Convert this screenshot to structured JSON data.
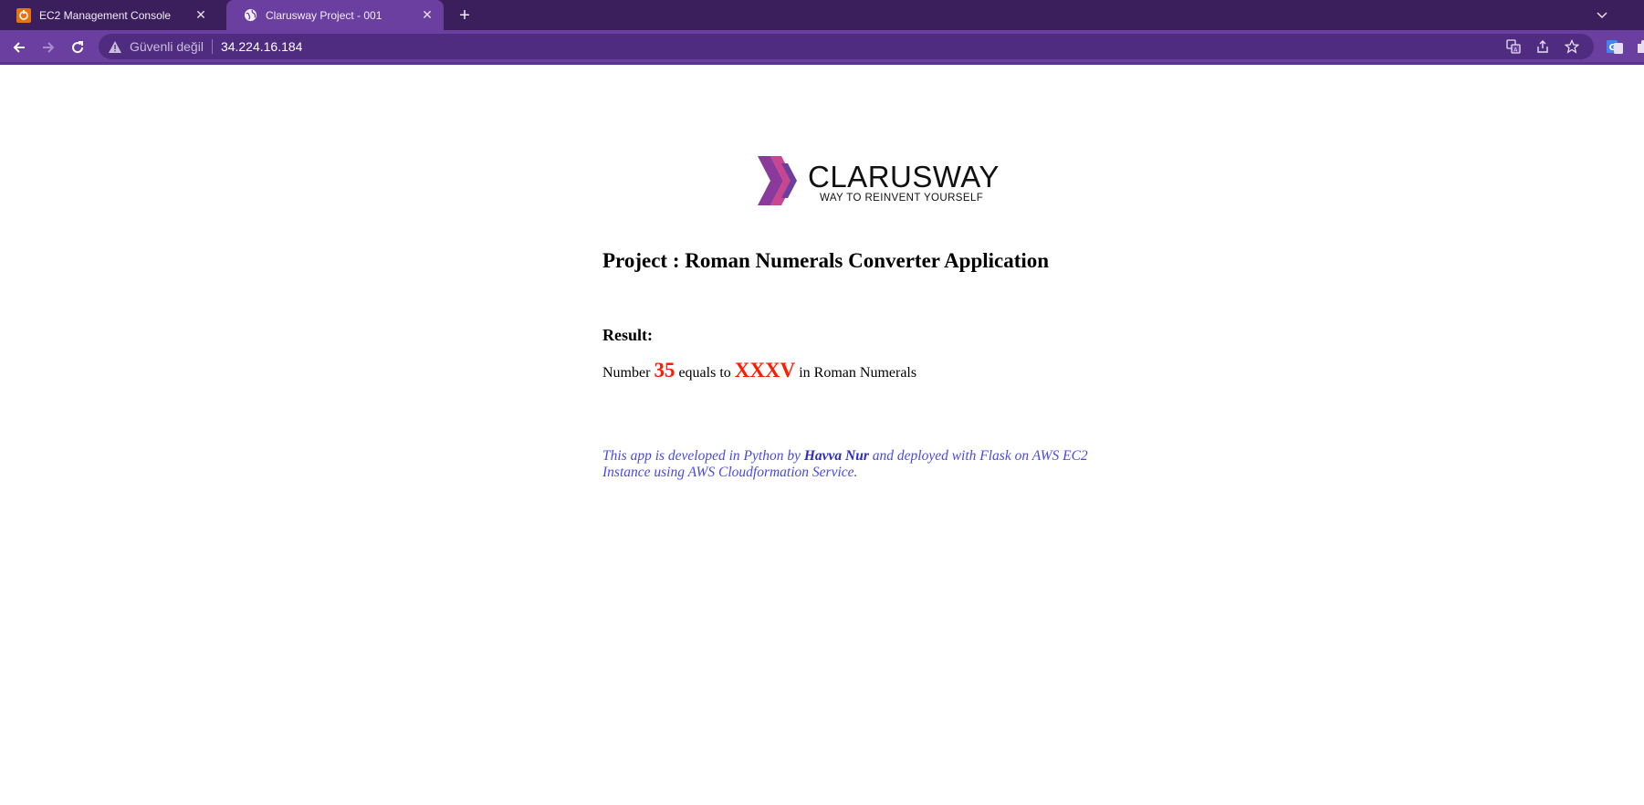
{
  "browser": {
    "tabs": [
      {
        "title": "EC2 Management Console",
        "favicon": "aws-console-icon",
        "active": false
      },
      {
        "title": "Clarusway Project - 001",
        "favicon": "globe-icon",
        "active": true
      }
    ],
    "new_tab_icon": "plus-icon",
    "tab_search_icon": "chevron-down-icon",
    "address_bar": {
      "security_text": "Güvenli değil",
      "security_icon": "warning-triangle-icon",
      "url": "34.224.16.184"
    },
    "colors": {
      "tabstrip": "#3b1f5c",
      "toolbar": "#6b3fa0",
      "omnibox": "#4f2c80"
    }
  },
  "page": {
    "logo": {
      "brand": "CLARUSWAY",
      "tagline": "WAY TO REINVENT YOURSELF"
    },
    "title": "Project : Roman Numerals Converter Application",
    "result_label": "Result:",
    "result": {
      "prefix": "Number",
      "number": "35",
      "middle": "equals to",
      "roman": "XXXV",
      "suffix": "in Roman Numerals"
    },
    "footer": {
      "part1": "This app is developed in Python by",
      "author": "Havva Nur",
      "part2": "and deployed with Flask on AWS EC2 Instance using AWS Cloudformation Service."
    },
    "accent_color": "#ff1a00",
    "footer_color": "#4a4ae0"
  }
}
